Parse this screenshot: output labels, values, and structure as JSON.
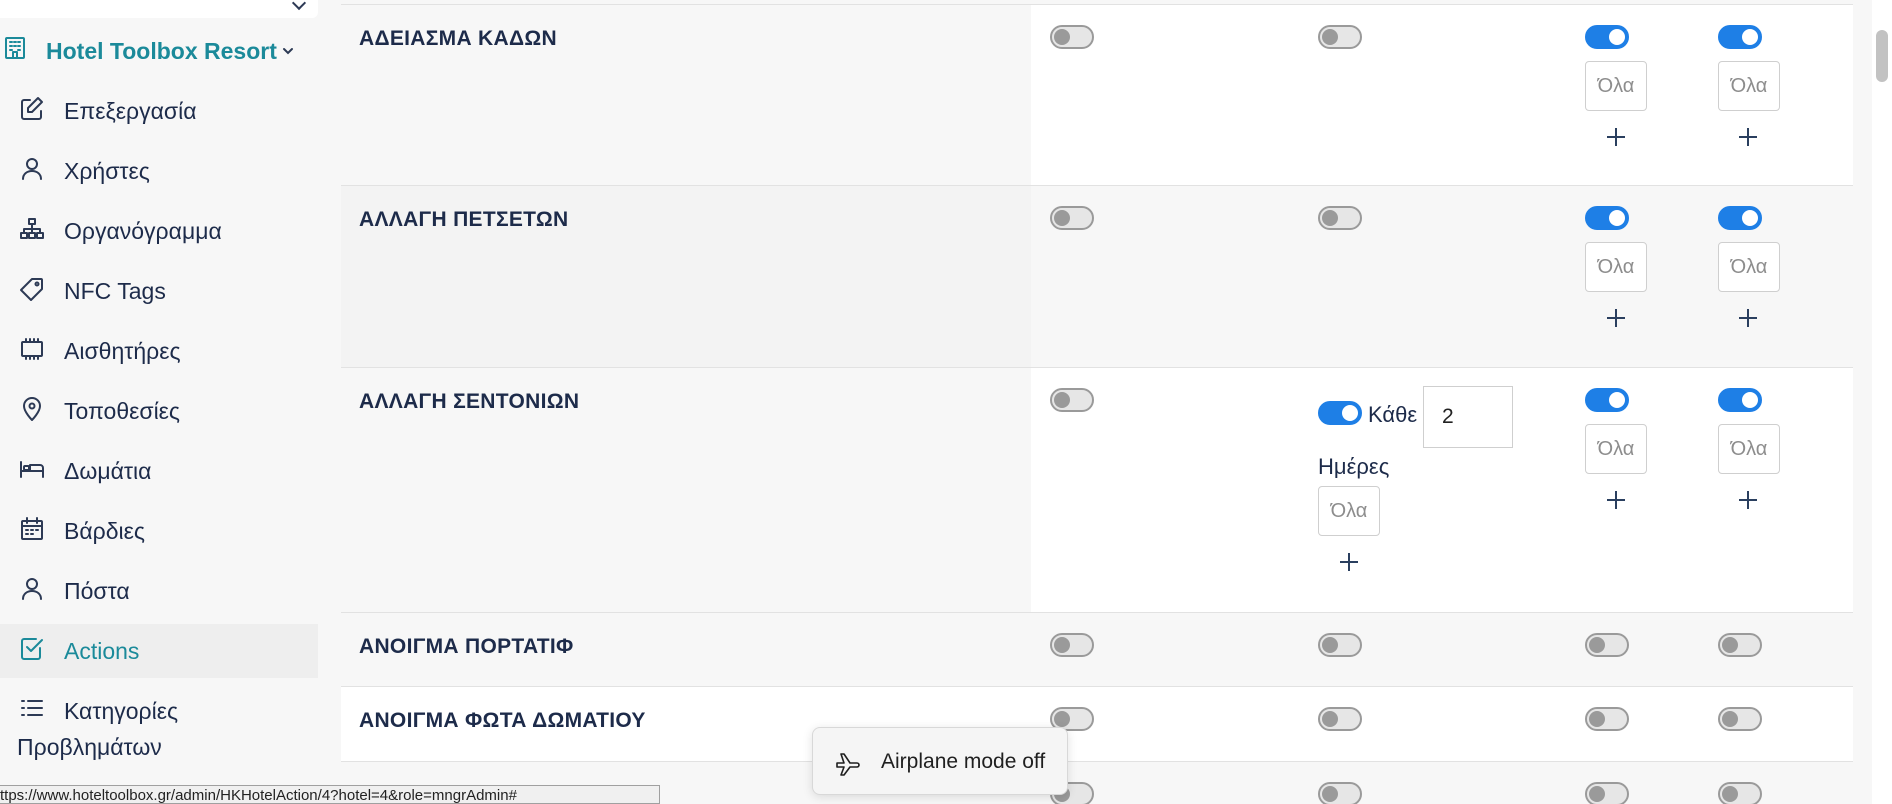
{
  "sidebar": {
    "hotel_name": "Hotel Toolbox Resort",
    "items": [
      {
        "label": "Επεξεργασία",
        "icon": "edit-icon"
      },
      {
        "label": "Χρήστες",
        "icon": "user-icon"
      },
      {
        "label": "Οργανόγραμμα",
        "icon": "org-chart-icon"
      },
      {
        "label": "NFC Tags",
        "icon": "tag-icon"
      },
      {
        "label": "Αισθητήρες",
        "icon": "sensor-chip-icon"
      },
      {
        "label": "Τοποθεσίες",
        "icon": "map-pin-icon"
      },
      {
        "label": "Δωμάτια",
        "icon": "bed-icon"
      },
      {
        "label": "Βάρδιες",
        "icon": "calendar-icon"
      },
      {
        "label": "Πόστα",
        "icon": "user-icon"
      },
      {
        "label": "Actions",
        "icon": "checkbox-icon",
        "active": true
      },
      {
        "label": "Κατηγορίες",
        "label_line2": "Προβλημάτων",
        "icon": "list-icon"
      }
    ]
  },
  "status_url": "ttps://www.hoteltoolbox.gr/admin/HKHotelAction/4?hotel=4&role=mngrAdmin#",
  "placeholder_all": "Όλα",
  "rows": [
    {
      "name": "ΑΔΕΙΑΣΜΑ ΚΑΔΩΝ",
      "toggles": [
        false,
        false,
        true,
        true
      ]
    },
    {
      "name": "ΑΛΛΑΓΗ ΠΕΤΣΕΤΩΝ",
      "toggles": [
        false,
        false,
        true,
        true
      ]
    },
    {
      "name": "ΑΛΛΑΓΗ ΣΕΝΤΟΝΙΩΝ",
      "toggles": [
        false,
        true,
        true,
        true
      ],
      "every_label": "Κάθε",
      "every_value": "2",
      "days_label": "Ημέρες"
    },
    {
      "name": "ΑΝΟΙΓΜΑ ΠΟΡΤΑΤΙΦ",
      "toggles": [
        false,
        false,
        false,
        false
      ]
    },
    {
      "name": "ΑΝΟΙΓΜΑ ΦΩΤΑ ΔΩΜΑΤΙΟΥ",
      "toggles": [
        false,
        false,
        false,
        false
      ]
    },
    {
      "name": "",
      "toggles": [
        false,
        false,
        false,
        false
      ]
    }
  ],
  "toast": {
    "message": "Airplane mode off",
    "icon": "airplane-icon"
  },
  "colors": {
    "accent": "#1b8a9a",
    "toggle_on": "#1e7fe6",
    "text": "#1d2b4a"
  }
}
